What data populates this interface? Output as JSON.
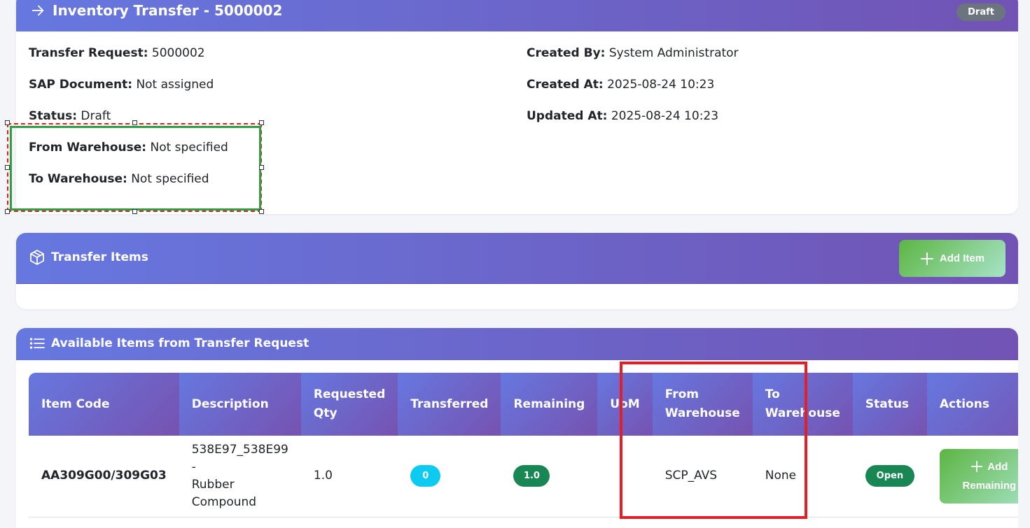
{
  "header": {
    "title": "Inventory Transfer - 5000002",
    "status_badge": "Draft"
  },
  "details": {
    "transfer_request_label": "Transfer Request:",
    "transfer_request_value": "5000002",
    "sap_document_label": "SAP Document:",
    "sap_document_value": "Not assigned",
    "status_label": "Status:",
    "status_value": "Draft",
    "from_warehouse_label": "From Warehouse:",
    "from_warehouse_value": "Not specified",
    "to_warehouse_label": "To Warehouse:",
    "to_warehouse_value": "Not specified",
    "created_by_label": "Created By:",
    "created_by_value": "System Administrator",
    "created_at_label": "Created At:",
    "created_at_value": "2025-08-24 10:23",
    "updated_at_label": "Updated At:",
    "updated_at_value": "2025-08-24 10:23"
  },
  "transfer_items": {
    "title": "Transfer Items",
    "add_item_label": "Add Item"
  },
  "available_items": {
    "title": "Available Items from Transfer Request",
    "columns": {
      "item_code": "Item Code",
      "description": "Description",
      "requested_qty_1": "Requested",
      "requested_qty_2": "Qty",
      "transferred": "Transferred",
      "remaining": "Remaining",
      "uom": "UoM",
      "from_wh_1": "From",
      "from_wh_2": "Warehouse",
      "to_wh_1": "To",
      "to_wh_2": "Warehouse",
      "status": "Status",
      "actions": "Actions"
    },
    "rows": [
      {
        "item_code": "AA309G00/309G03",
        "description_1": "538E97_538E99 -",
        "description_2": "Rubber Compound",
        "requested_qty": "1.0",
        "transferred": "0",
        "remaining": "1.0",
        "uom": "",
        "from_warehouse": "SCP_AVS",
        "to_warehouse": "None",
        "status": "Open",
        "action_1": "Add",
        "action_2": "Remaining"
      }
    ]
  },
  "colors": {
    "header_gradient_start": "#6678e0",
    "header_gradient_end": "#7153b4",
    "success": "#198754",
    "info": "#0dcaf0",
    "secondary": "#6c757d",
    "highlight_red": "#e41e26",
    "highlight_green": "#2f9e44"
  },
  "icons": {
    "title_icon": "arrow-right-icon",
    "transfer_items_icon": "box-icon",
    "available_items_icon": "list-icon",
    "add_icon": "plus-icon"
  }
}
